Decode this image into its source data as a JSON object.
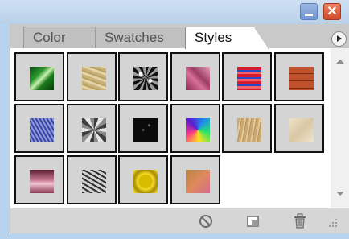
{
  "tabs": [
    {
      "label": "Color",
      "active": false
    },
    {
      "label": "Swatches",
      "active": false
    },
    {
      "label": "Styles",
      "active": true
    }
  ],
  "window_controls": {
    "close_glyph": "✕"
  },
  "styles": [
    {
      "name": "green-swirl",
      "fill": "linear-gradient(135deg,#0a4a12 0%,#2e9b2e 35%,#c9f0b0 50%,#1c7a1c 65%,#073b0b 100%)"
    },
    {
      "name": "tan-marble",
      "fill": "repeating-linear-gradient(20deg,#c9b27a 0 3px,#e3d3a5 3px 6px,#b89f62 6px 8px)"
    },
    {
      "name": "black-noise",
      "fill": "radial-gradient(circle at 30% 30%,#fff 0 2px,transparent 3px),radial-gradient(circle at 70% 60%,#eee 0 2px,transparent 3px),repeating-conic-gradient(#111 0 15deg,#9a9a9a 15deg 30deg)"
    },
    {
      "name": "pink-tiles",
      "fill": "linear-gradient(45deg,#8a2c53 0%,#d67096 40%,#9d3c66 60%,#e7a0b8 100%)"
    },
    {
      "name": "red-stripes",
      "fill": "repeating-linear-gradient(180deg,#d81b2e 0 4px,#2b49c7 4px 6px,#f5616b 6px 9px)"
    },
    {
      "name": "brick-orange",
      "fill": "repeating-linear-gradient(180deg,#c0522b 0 8px,#7a2f14 8px 9px)"
    },
    {
      "name": "blue-stripes",
      "fill": "repeating-linear-gradient(60deg,#3a47a8 0 2px,#8f9bd8 2px 4px)"
    },
    {
      "name": "gray-noise",
      "fill": "repeating-conic-gradient(#404040 0 20deg,#e6e6e6 20deg 40deg,#8d8d8d 40deg 60deg)"
    },
    {
      "name": "dark-speckle",
      "fill": "radial-gradient(circle at 40% 50%,#555 0 1px,transparent 2px),radial-gradient(circle at 65% 30%,#666 0 1px,transparent 2px),#0b0b0b"
    },
    {
      "name": "rainbow-chrome",
      "fill": "conic-gradient(from 30deg,#1c8cf0,#27e36a,#ffe21a,#ff3a85,#5b1ad0,#1c8cf0)"
    },
    {
      "name": "wood-grain",
      "fill": "repeating-linear-gradient(100deg,#c9a871 0 3px,#e3c997 3px 5px,#b8925a 5px 6px)"
    },
    {
      "name": "pale-parchment",
      "fill": "linear-gradient(135deg,#eee1c8,#d8c7a4 50%,#efe4cf)"
    },
    {
      "name": "pink-gradient",
      "fill": "linear-gradient(180deg,#5b1e2f 0%,#c87a93 45%,#f1c3d1 60%,#8b3a53 100%)"
    },
    {
      "name": "gray-crackle",
      "fill": "repeating-linear-gradient(30deg,#2e2e2e 0 2px,#d0d0d0 2px 5px),linear-gradient(#bbb,#777)"
    },
    {
      "name": "gold-bevel",
      "fill": "radial-gradient(circle,#d8bc00 0 40%,#f7e02b 45%,#a68a00 70%,#fff24a 100%)"
    },
    {
      "name": "copper-sunset",
      "fill": "linear-gradient(135deg,#b8833c 0%,#e08a5f 50%,#d36b8c 100%)"
    }
  ],
  "toolbar": {
    "clear_style_icon": "no-style-icon",
    "new_style_icon": "new-style-icon",
    "delete_style_icon": "trash-icon"
  }
}
